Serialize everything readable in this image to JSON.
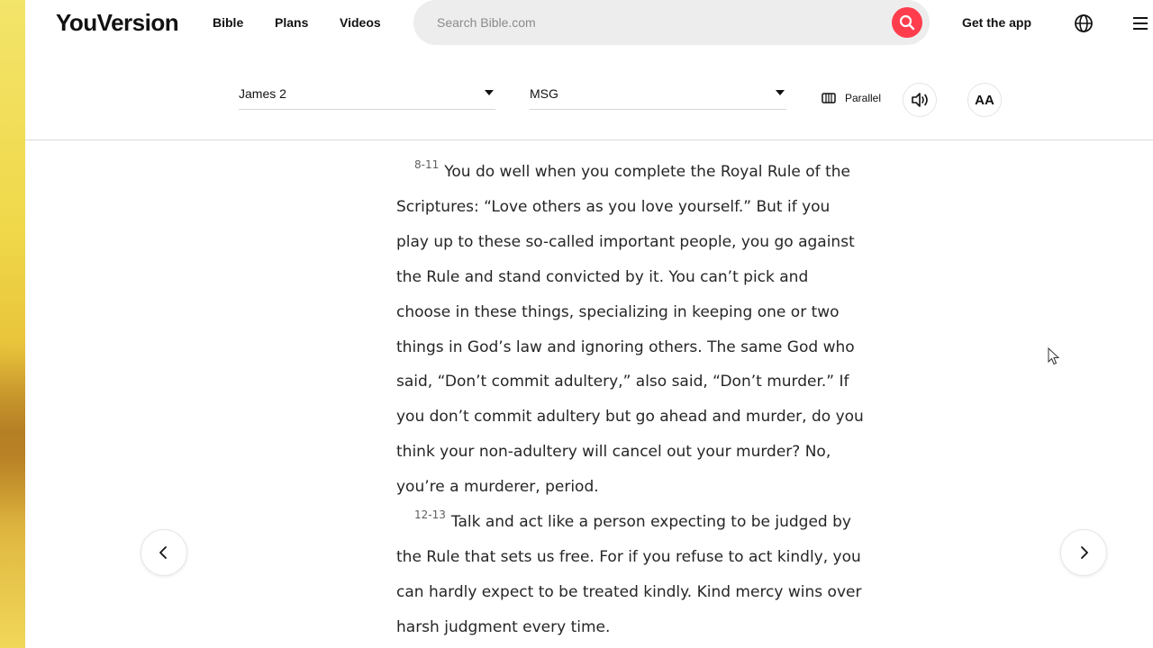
{
  "brand": {
    "logo": "YouVersion",
    "accent_color": "#ff3d4d"
  },
  "nav": {
    "links": [
      "Bible",
      "Plans",
      "Videos"
    ],
    "search_placeholder": "Search Bible.com",
    "get_app": "Get the app"
  },
  "toolbar": {
    "book_chapter": "James 2",
    "version": "MSG",
    "parallel_label": "Parallel",
    "font_button": "AA"
  },
  "reader": {
    "verses": [
      {
        "number": "8-11",
        "text": "You do well when you complete the Royal Rule of the Scriptures: “Love others as you love yourself.” But if you play up to these so-called important people, you go against the Rule and stand convicted by it. You can’t pick and choose in these things, specializing in keeping one or two things in God’s law and ignoring others. The same God who said, “Don’t commit adultery,” also said, “Don’t murder.” If you don’t commit adultery but go ahead and murder, do you think your non-adultery will cancel out your murder? No, you’re a murderer, period."
      },
      {
        "number": "12-13",
        "text": "Talk and act like a person expecting to be judged by the Rule that sets us free. For if you refuse to act kindly, you can hardly expect to be treated kindly. Kind mercy wins over harsh judgment every time."
      }
    ]
  },
  "icons": {
    "search": "search-icon",
    "globe": "globe-icon",
    "menu": "menu-icon",
    "parallel": "parallel-icon",
    "audio": "speaker-icon",
    "prev": "chevron-left-icon",
    "next": "chevron-right-icon"
  }
}
